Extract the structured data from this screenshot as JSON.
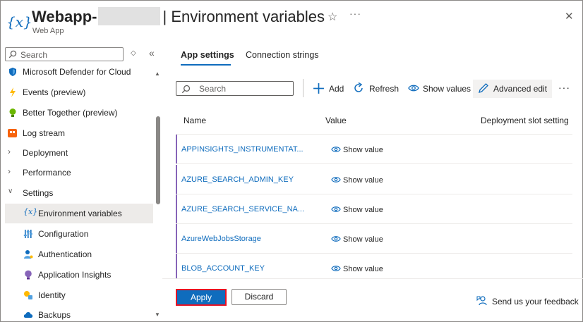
{
  "header": {
    "app_name": "Webapp-",
    "separator": "|",
    "page_title": "Environment variables",
    "subtitle": "Web App",
    "icon": "variable-icon",
    "star_icon": "star-icon",
    "more_icon": "more-icon",
    "close_icon": "close-icon"
  },
  "sidebar": {
    "search_placeholder": "Search",
    "items": [
      {
        "label": "Microsoft Defender for Cloud",
        "icon": "shield-icon"
      },
      {
        "label": "Events (preview)",
        "icon": "lightning-icon"
      },
      {
        "label": "Better Together (preview)",
        "icon": "bulb-icon"
      },
      {
        "label": "Log stream",
        "icon": "log-stream-icon"
      },
      {
        "label": "Deployment",
        "icon": "chevron-right-icon"
      },
      {
        "label": "Performance",
        "icon": "chevron-right-icon"
      },
      {
        "label": "Settings",
        "icon": "chevron-down-icon"
      },
      {
        "label": "Environment variables",
        "icon": "variable-icon"
      },
      {
        "label": "Configuration",
        "icon": "configuration-icon"
      },
      {
        "label": "Authentication",
        "icon": "authentication-icon"
      },
      {
        "label": "Application Insights",
        "icon": "insights-icon"
      },
      {
        "label": "Identity",
        "icon": "identity-icon"
      },
      {
        "label": "Backups",
        "icon": "backups-icon"
      }
    ]
  },
  "tabs": [
    {
      "label": "App settings",
      "active": true
    },
    {
      "label": "Connection strings",
      "active": false
    }
  ],
  "toolbar": {
    "search_placeholder": "Search",
    "add": "Add",
    "refresh": "Refresh",
    "show_values": "Show values",
    "advanced_edit": "Advanced edit"
  },
  "table": {
    "columns": [
      "Name",
      "Value",
      "Deployment slot setting"
    ],
    "rows": [
      {
        "name": "APPINSIGHTS_INSTRUMENTAT...",
        "value": "Show value"
      },
      {
        "name": "AZURE_SEARCH_ADMIN_KEY",
        "value": "Show value"
      },
      {
        "name": "AZURE_SEARCH_SERVICE_NA...",
        "value": "Show value"
      },
      {
        "name": "AzureWebJobsStorage",
        "value": "Show value"
      },
      {
        "name": "BLOB_ACCOUNT_KEY",
        "value": "Show value"
      }
    ]
  },
  "footer": {
    "apply": "Apply",
    "discard": "Discard",
    "feedback": "Send us your feedback"
  },
  "colors": {
    "accent": "#0f6cbd",
    "row_marker": "#8764b8",
    "apply_highlight": "#e81123"
  }
}
